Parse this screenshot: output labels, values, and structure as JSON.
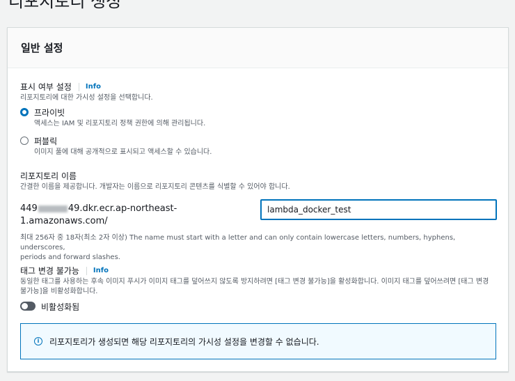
{
  "page": {
    "title": "리포지토리 생성"
  },
  "general": {
    "header": "일반 설정",
    "visibility": {
      "label": "표시 여부 설정",
      "info": "Info",
      "description": "리포지토리에 대한 가시성 설정을 선택합니다.",
      "options": [
        {
          "label": "프라이빗",
          "description": "액세스는 IAM 및 리포지토리 정책 권한에 의해 관리됩니다.",
          "selected": true
        },
        {
          "label": "퍼블릭",
          "description": "이미지 풀에 대해 공개적으로 표시되고 액세스할 수 있습니다.",
          "selected": false
        }
      ]
    },
    "repo_name": {
      "label": "리포지토리 이름",
      "description": "간결한 이름을 제공합니다. 개발자는 이름으로 리포지토리 콘텐츠를 식별할 수 있어야 합니다.",
      "uri_prefix_start": "449",
      "uri_prefix_end": "49.dkr.ecr.ap-northeast-",
      "uri_line2": "1.amazonaws.com/",
      "value": "lambda_docker_test",
      "constraint_line1": "최대 256자 중 18자(최소 2자 이상) The name must start with a letter and can only contain lowercase letters, numbers, hyphens, underscores,",
      "constraint_line2": "periods and forward slashes."
    },
    "tag_immutability": {
      "label": "태그 변경 불가능",
      "info": "Info",
      "description_line1": "동일한 태그를 사용하는 후속 이미지 푸시가 이미지 태그를 덮어쓰지 않도록 방지하려면 [태그 변경 불가능]을 활성화합니다. 이미지 태그를 덮어쓰려면 [태그 변경",
      "description_line2": "불가능]을 비활성화합니다.",
      "toggle_label": "비활성화됨"
    },
    "alert": {
      "icon": "info-icon",
      "text": "리포지토리가 생성되면 해당 리포지토리의 가시성 설정을 변경할 수 없습니다."
    }
  },
  "colors": {
    "accent": "#0073bb",
    "background": "#f2f3f3",
    "toggle_off": "#545b64"
  }
}
